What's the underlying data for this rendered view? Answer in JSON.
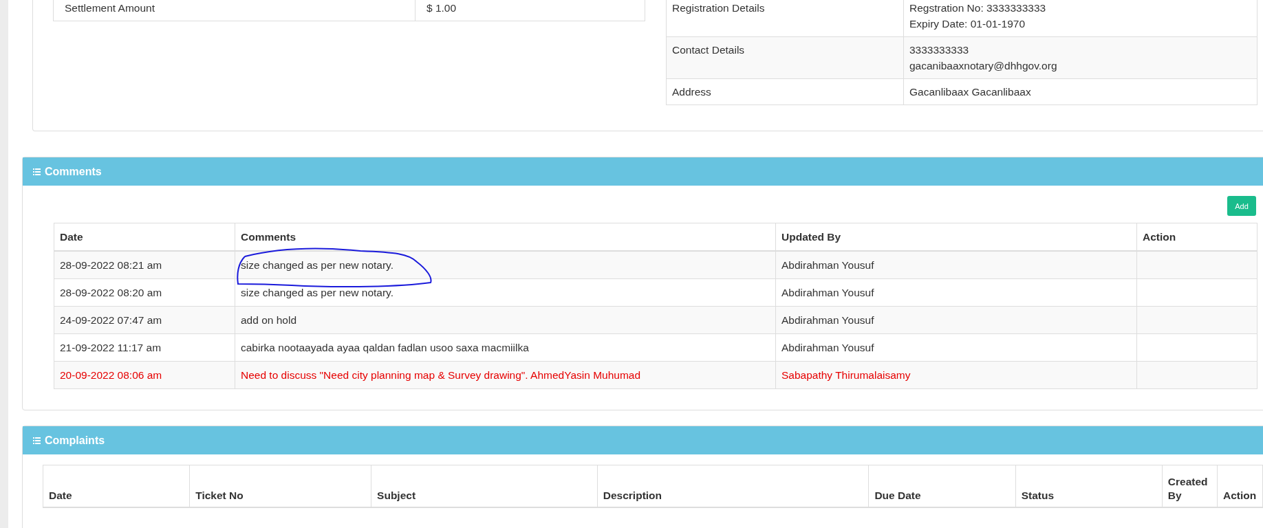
{
  "settlement_table": {
    "rows": [
      {
        "label": "Settlement Amount",
        "value": [
          "$ 1.00"
        ]
      }
    ]
  },
  "registration_table": {
    "rows": [
      {
        "label": "Registration Details",
        "value": [
          "Regstration No: 3333333333",
          "Expiry Date: 01-01-1970"
        ]
      },
      {
        "label": "Contact Details",
        "value": [
          "3333333333",
          "gacanibaaxnotary@dhhgov.org"
        ]
      },
      {
        "label": "Address",
        "value": [
          "Gacanlibaax Gacanlibaax"
        ]
      }
    ]
  },
  "comments_panel": {
    "title": "Comments",
    "add_button": "Add",
    "columns": [
      "Date",
      "Comments",
      "Updated By",
      "Action"
    ],
    "rows": [
      {
        "date": "28-09-2022 08:21 am",
        "comment": "size changed as per new notary.",
        "updated_by": "Abdirahman Yousuf",
        "flagged": false,
        "circled": true
      },
      {
        "date": "28-09-2022 08:20 am",
        "comment": "size changed as per new notary.",
        "updated_by": "Abdirahman Yousuf",
        "flagged": false,
        "circled": false
      },
      {
        "date": "24-09-2022 07:47 am",
        "comment": "add on hold",
        "updated_by": "Abdirahman Yousuf",
        "flagged": false,
        "circled": false
      },
      {
        "date": "21-09-2022 11:17 am",
        "comment": "cabirka nootaayada ayaa qaldan fadlan usoo saxa macmiilka",
        "updated_by": "Abdirahman Yousuf",
        "flagged": false,
        "circled": false
      },
      {
        "date": "20-09-2022 08:06 am",
        "comment": "Need to discuss \"Need city planning map & Survey drawing\". AhmedYasin Muhumad",
        "updated_by": "Sabapathy Thirumalaisamy",
        "flagged": true,
        "circled": false
      }
    ]
  },
  "complaints_panel": {
    "title": "Complaints",
    "columns": [
      "Date",
      "Ticket No",
      "Subject",
      "Description",
      "Due Date",
      "Status",
      "Created By",
      "Action"
    ]
  }
}
